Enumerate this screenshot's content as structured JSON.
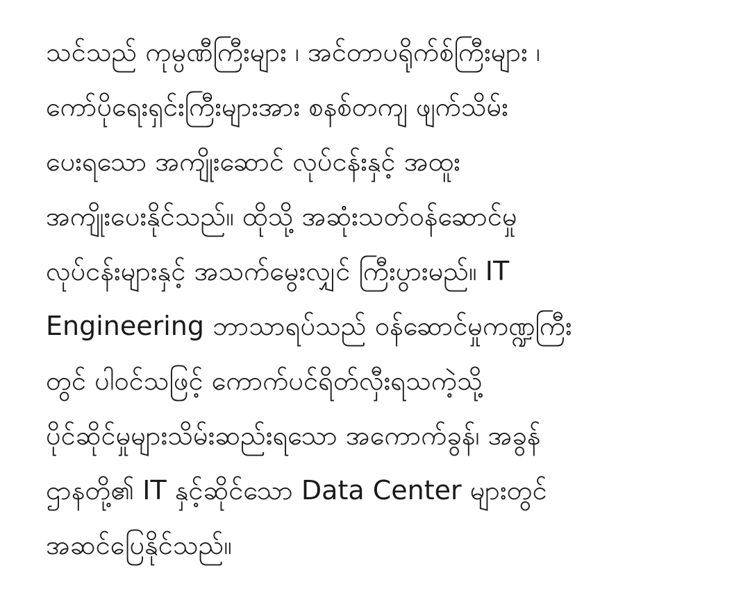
{
  "document": {
    "lines": [
      "သင်သည် ကုမ္ပဏီကြီးများ ၊ အင်တာပရိုက်စ်ကြီးများ ၊",
      "ကော်ပိုရေးရှင်းကြီးများအား စနစ်တကျ ဖျက်သိမ်း",
      "ပေးရသော အကျိုးဆောင် လုပ်ငန်းနှင့် အထူး",
      "အကျိုးပေးနိုင်သည်။ ထိုသို့ အဆုံးသတ်ဝန်ဆောင်မှု",
      "လုပ်ငန်းများနှင့် အသက်မွေးလျှင် ကြီးပွားမည်။ IT",
      "Engineering ဘာသာရပ်သည် ဝန်ဆောင်မှုကဏ္ဍကြီး",
      "တွင် ပါဝင်သဖြင့် ကောက်ပင်ရိတ်လှီးရသကဲ့သို့",
      "ပိုင်ဆိုင်မှုများသိမ်းဆည်းရသော အကောက်ခွန်၊ အခွန်",
      "ဌာနတို့၏ IT နှင့်ဆိုင်သော Data Center များတွင်",
      "အဆင်ပြေနိုင်သည်။"
    ]
  }
}
